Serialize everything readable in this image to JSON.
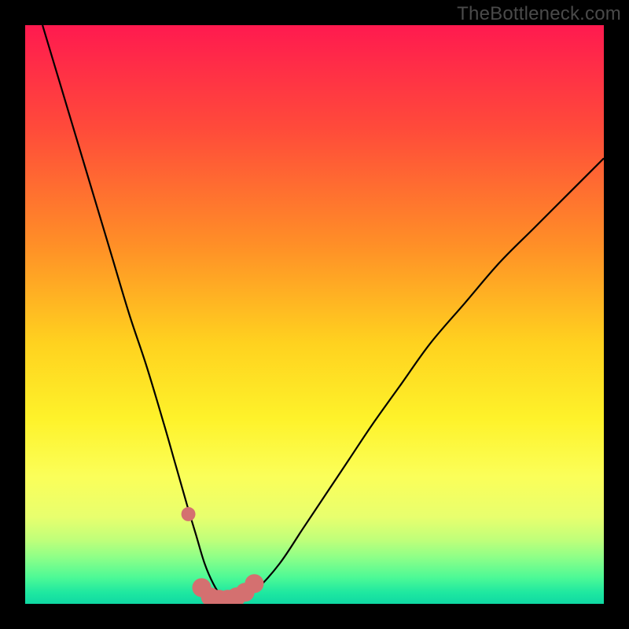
{
  "watermark": "TheBottleneck.com",
  "chart_data": {
    "type": "line",
    "title": "",
    "xlabel": "",
    "ylabel": "",
    "xlim": [
      0,
      100
    ],
    "ylim": [
      0,
      100
    ],
    "grid": false,
    "series": [
      {
        "name": "bottleneck-curve",
        "x": [
          3,
          6,
          9,
          12,
          15,
          18,
          21,
          24,
          26,
          28,
          29.5,
          31,
          32.5,
          34,
          35.5,
          37,
          40,
          44,
          48,
          52,
          56,
          60,
          65,
          70,
          76,
          82,
          88,
          94,
          100
        ],
        "y": [
          100,
          90,
          80,
          70,
          60,
          50,
          41,
          31,
          24,
          17,
          12,
          7,
          3.5,
          1.2,
          0.2,
          0.5,
          2.5,
          7,
          13,
          19,
          25,
          31,
          38,
          45,
          52,
          59,
          65,
          71,
          77
        ]
      },
      {
        "name": "highlight-dots",
        "x": [
          28.2,
          30.5,
          32.0,
          33.5,
          35.0,
          36.5,
          38.0,
          39.6
        ],
        "y": [
          15.5,
          2.8,
          1.2,
          0.8,
          0.8,
          1.2,
          2.0,
          3.5
        ]
      }
    ],
    "gradient_stops": [
      {
        "offset": 0.0,
        "color": "#ff1a4f"
      },
      {
        "offset": 0.18,
        "color": "#ff4b3a"
      },
      {
        "offset": 0.38,
        "color": "#ff8f27"
      },
      {
        "offset": 0.55,
        "color": "#ffd21f"
      },
      {
        "offset": 0.68,
        "color": "#fef22a"
      },
      {
        "offset": 0.78,
        "color": "#fbff59"
      },
      {
        "offset": 0.85,
        "color": "#e8ff6e"
      },
      {
        "offset": 0.89,
        "color": "#bfff7a"
      },
      {
        "offset": 0.92,
        "color": "#8dff88"
      },
      {
        "offset": 0.955,
        "color": "#4cf996"
      },
      {
        "offset": 0.98,
        "color": "#1fe8a0"
      },
      {
        "offset": 1.0,
        "color": "#0fd9a3"
      }
    ],
    "highlight_color": "#d47070",
    "curve_color": "#000000"
  }
}
